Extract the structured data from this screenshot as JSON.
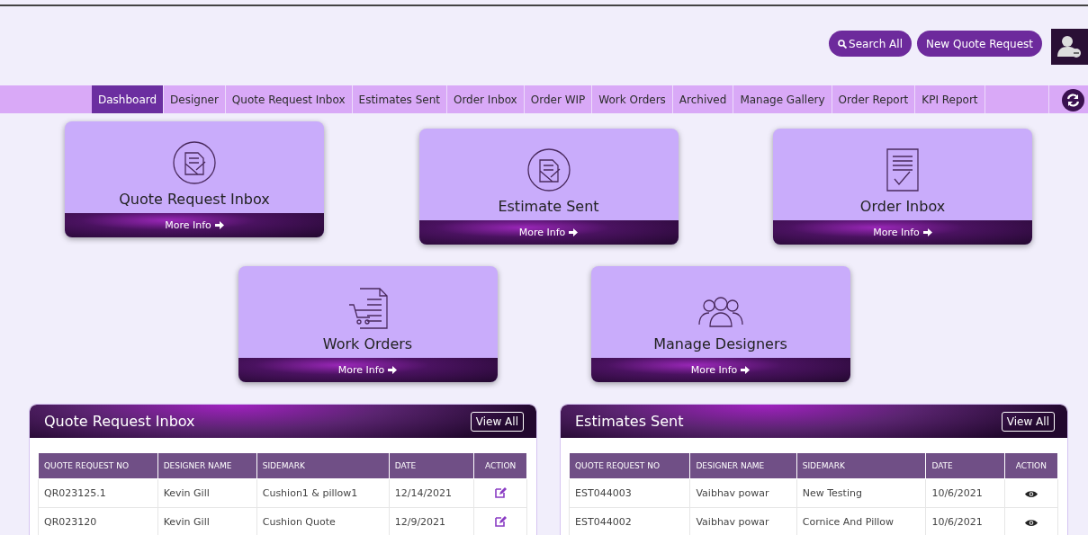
{
  "header": {
    "buttons": [
      {
        "kind": "search",
        "label": "Search All"
      },
      {
        "kind": "plain",
        "label": "New Quote Request"
      }
    ]
  },
  "nav": {
    "tabs": [
      {
        "label": "Dashboard",
        "selected": true
      },
      {
        "label": "Designer",
        "selected": false
      },
      {
        "label": "Quote Request Inbox",
        "selected": false
      },
      {
        "label": "Estimates Sent",
        "selected": false
      },
      {
        "label": "Order Inbox",
        "selected": false
      },
      {
        "label": "Order WIP",
        "selected": false
      },
      {
        "label": "Work Orders",
        "selected": false
      },
      {
        "label": "Archived",
        "selected": false
      },
      {
        "label": "Manage Gallery",
        "selected": false
      },
      {
        "label": "Order Report",
        "selected": false
      },
      {
        "label": "KPI Report",
        "selected": false
      }
    ]
  },
  "cards": [
    [
      {
        "kind": "doc-circle",
        "title": "Quote Request Inbox",
        "link": "More Info"
      },
      {
        "kind": "doc-circle",
        "title": "Estimate Sent",
        "link": "More Info"
      },
      {
        "kind": "doc-lines",
        "title": "Order Inbox",
        "link": "More Info"
      }
    ],
    [
      {
        "kind": "doc-cart",
        "title": "Work Orders",
        "link": "More Info"
      },
      {
        "kind": "people",
        "title": "Manage Designers",
        "link": "More Info"
      }
    ]
  ],
  "panels": [
    {
      "title": "Quote Request Inbox",
      "button": "View All",
      "kind": "edit",
      "columns": [
        "QUOTE REQUEST NO",
        "DESIGNER NAME",
        "SIDEMARK",
        "DATE",
        "ACTION"
      ],
      "rows": [
        [
          "QR023125.1",
          "Kevin Gill",
          "Cushion1 & pillow1",
          "12/14/2021"
        ],
        [
          "QR023120",
          "Kevin Gill",
          "Cushion Quote",
          "12/9/2021"
        ]
      ]
    },
    {
      "title": "Estimates Sent",
      "button": "View All",
      "kind": "view",
      "columns": [
        "QUOTE REQUEST NO",
        "DESIGNER NAME",
        "SIDEMARK",
        "DATE",
        "ACTION"
      ],
      "rows": [
        [
          "EST044003",
          "Vaibhav powar",
          "New Testing",
          "10/6/2021"
        ],
        [
          "EST044002",
          "Vaibhav powar",
          "Cornice And Pillow",
          "10/6/2021"
        ]
      ]
    }
  ]
}
